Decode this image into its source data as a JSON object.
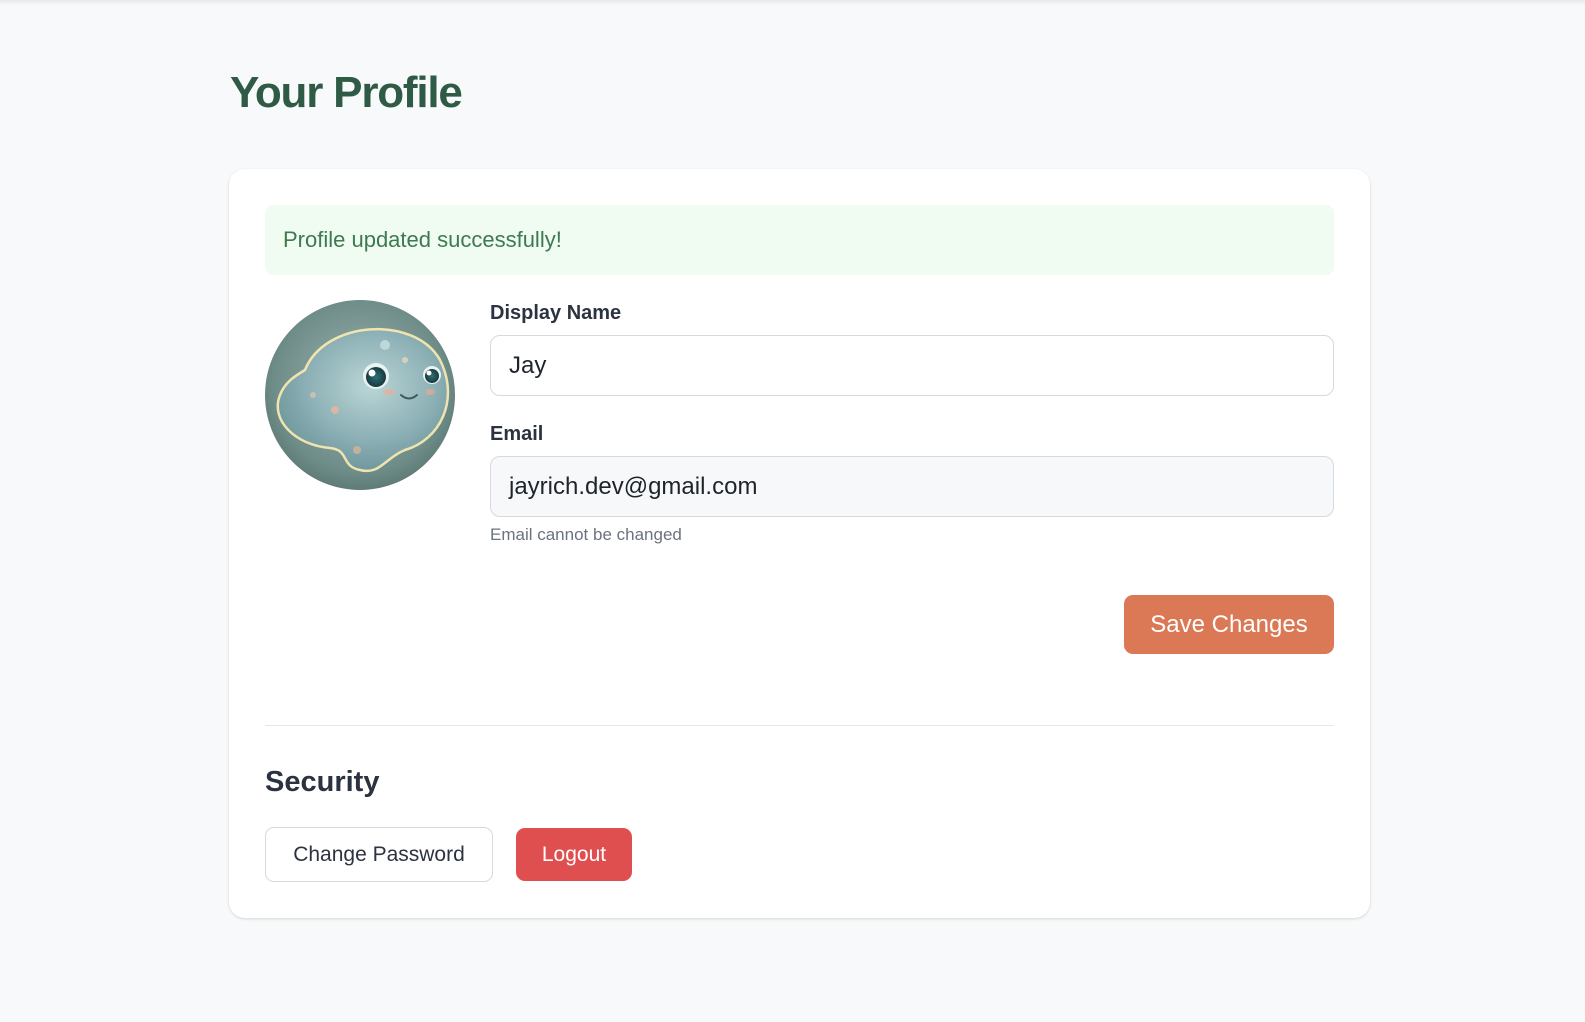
{
  "page": {
    "title": "Your Profile"
  },
  "alert": {
    "message": "Profile updated successfully!"
  },
  "avatar": {
    "description_icon": "avatar-icon"
  },
  "form": {
    "display_name": {
      "label": "Display Name",
      "value": "Jay"
    },
    "email": {
      "label": "Email",
      "value": "jayrich.dev@gmail.com",
      "help": "Email cannot be changed"
    },
    "save_label": "Save Changes"
  },
  "security": {
    "title": "Security",
    "change_password_label": "Change Password",
    "logout_label": "Logout"
  },
  "colors": {
    "title": "#2f5a46",
    "success_bg": "#f0fbf1",
    "success_text": "#3d7a50",
    "primary": "#db7856",
    "danger": "#e04f4f"
  }
}
